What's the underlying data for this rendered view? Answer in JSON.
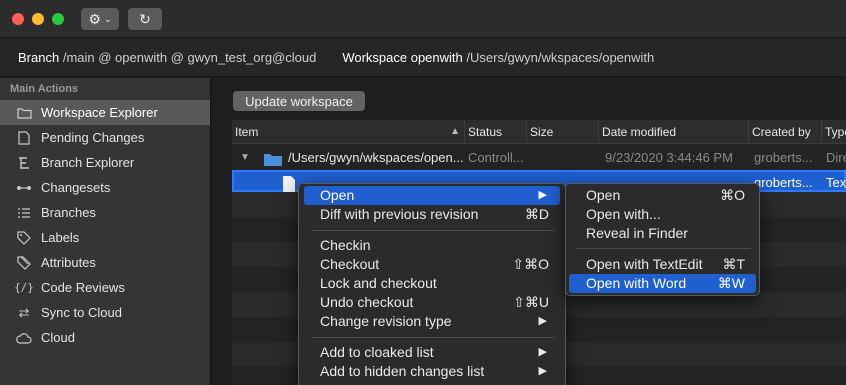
{
  "titlebar": {
    "settings_icon": "gear-icon",
    "refresh_icon": "refresh-icon"
  },
  "info": {
    "branch_label": "Branch",
    "branch_value": "/main @ openwith @ gwyn_test_org@cloud",
    "workspace_label": "Workspace openwith",
    "workspace_value": "/Users/gwyn/wkspaces/openwith"
  },
  "sidebar": {
    "header": "Main Actions",
    "items": [
      {
        "label": "Workspace Explorer",
        "icon": "folder-icon"
      },
      {
        "label": "Pending Changes",
        "icon": "document-icon"
      },
      {
        "label": "Branch Explorer",
        "icon": "branch-icon"
      },
      {
        "label": "Changesets",
        "icon": "changeset-icon"
      },
      {
        "label": "Branches",
        "icon": "list-icon"
      },
      {
        "label": "Labels",
        "icon": "tag-icon"
      },
      {
        "label": "Attributes",
        "icon": "attributes-icon"
      },
      {
        "label": "Code Reviews",
        "icon": "code-review-icon"
      },
      {
        "label": "Sync to Cloud",
        "icon": "sync-icon"
      },
      {
        "label": "Cloud",
        "icon": "cloud-icon"
      }
    ]
  },
  "main": {
    "update_button": "Update workspace",
    "columns": [
      "Item",
      "Status",
      "Size",
      "Date modified",
      "Created by",
      "Type"
    ],
    "rows": [
      {
        "item": "/Users/gwyn/wkspaces/open...",
        "status": "Controll...",
        "size": "",
        "date": "9/23/2020 3:44:46 PM",
        "created_by": "groberts...",
        "type": "Dire"
      },
      {
        "item": "",
        "status": "",
        "size": "",
        "date": "",
        "created_by": "groberts...",
        "type": "Tex"
      }
    ]
  },
  "context_menu": {
    "items": [
      {
        "label": "Open",
        "shortcut": "",
        "submenu": true
      },
      {
        "label": "Diff with previous revision",
        "shortcut": "⌘D"
      },
      {
        "label": "Checkin",
        "shortcut": ""
      },
      {
        "label": "Checkout",
        "shortcut": "⇧⌘O"
      },
      {
        "label": "Lock and checkout",
        "shortcut": ""
      },
      {
        "label": "Undo checkout",
        "shortcut": "⇧⌘U"
      },
      {
        "label": "Change revision type",
        "shortcut": "",
        "submenu": true
      },
      {
        "label": "Add to cloaked list",
        "shortcut": "",
        "submenu": true
      },
      {
        "label": "Add to hidden changes list",
        "shortcut": "",
        "submenu": true
      }
    ]
  },
  "open_submenu": {
    "items": [
      {
        "label": "Open",
        "shortcut": "⌘O"
      },
      {
        "label": "Open with...",
        "shortcut": ""
      },
      {
        "label": "Reveal in Finder",
        "shortcut": ""
      },
      {
        "label": "Open with TextEdit",
        "shortcut": "⌘T"
      },
      {
        "label": "Open with Word",
        "shortcut": "⌘W"
      }
    ]
  },
  "colors": {
    "accent": "#1f5fcf",
    "sidebar_active": "#595959"
  }
}
